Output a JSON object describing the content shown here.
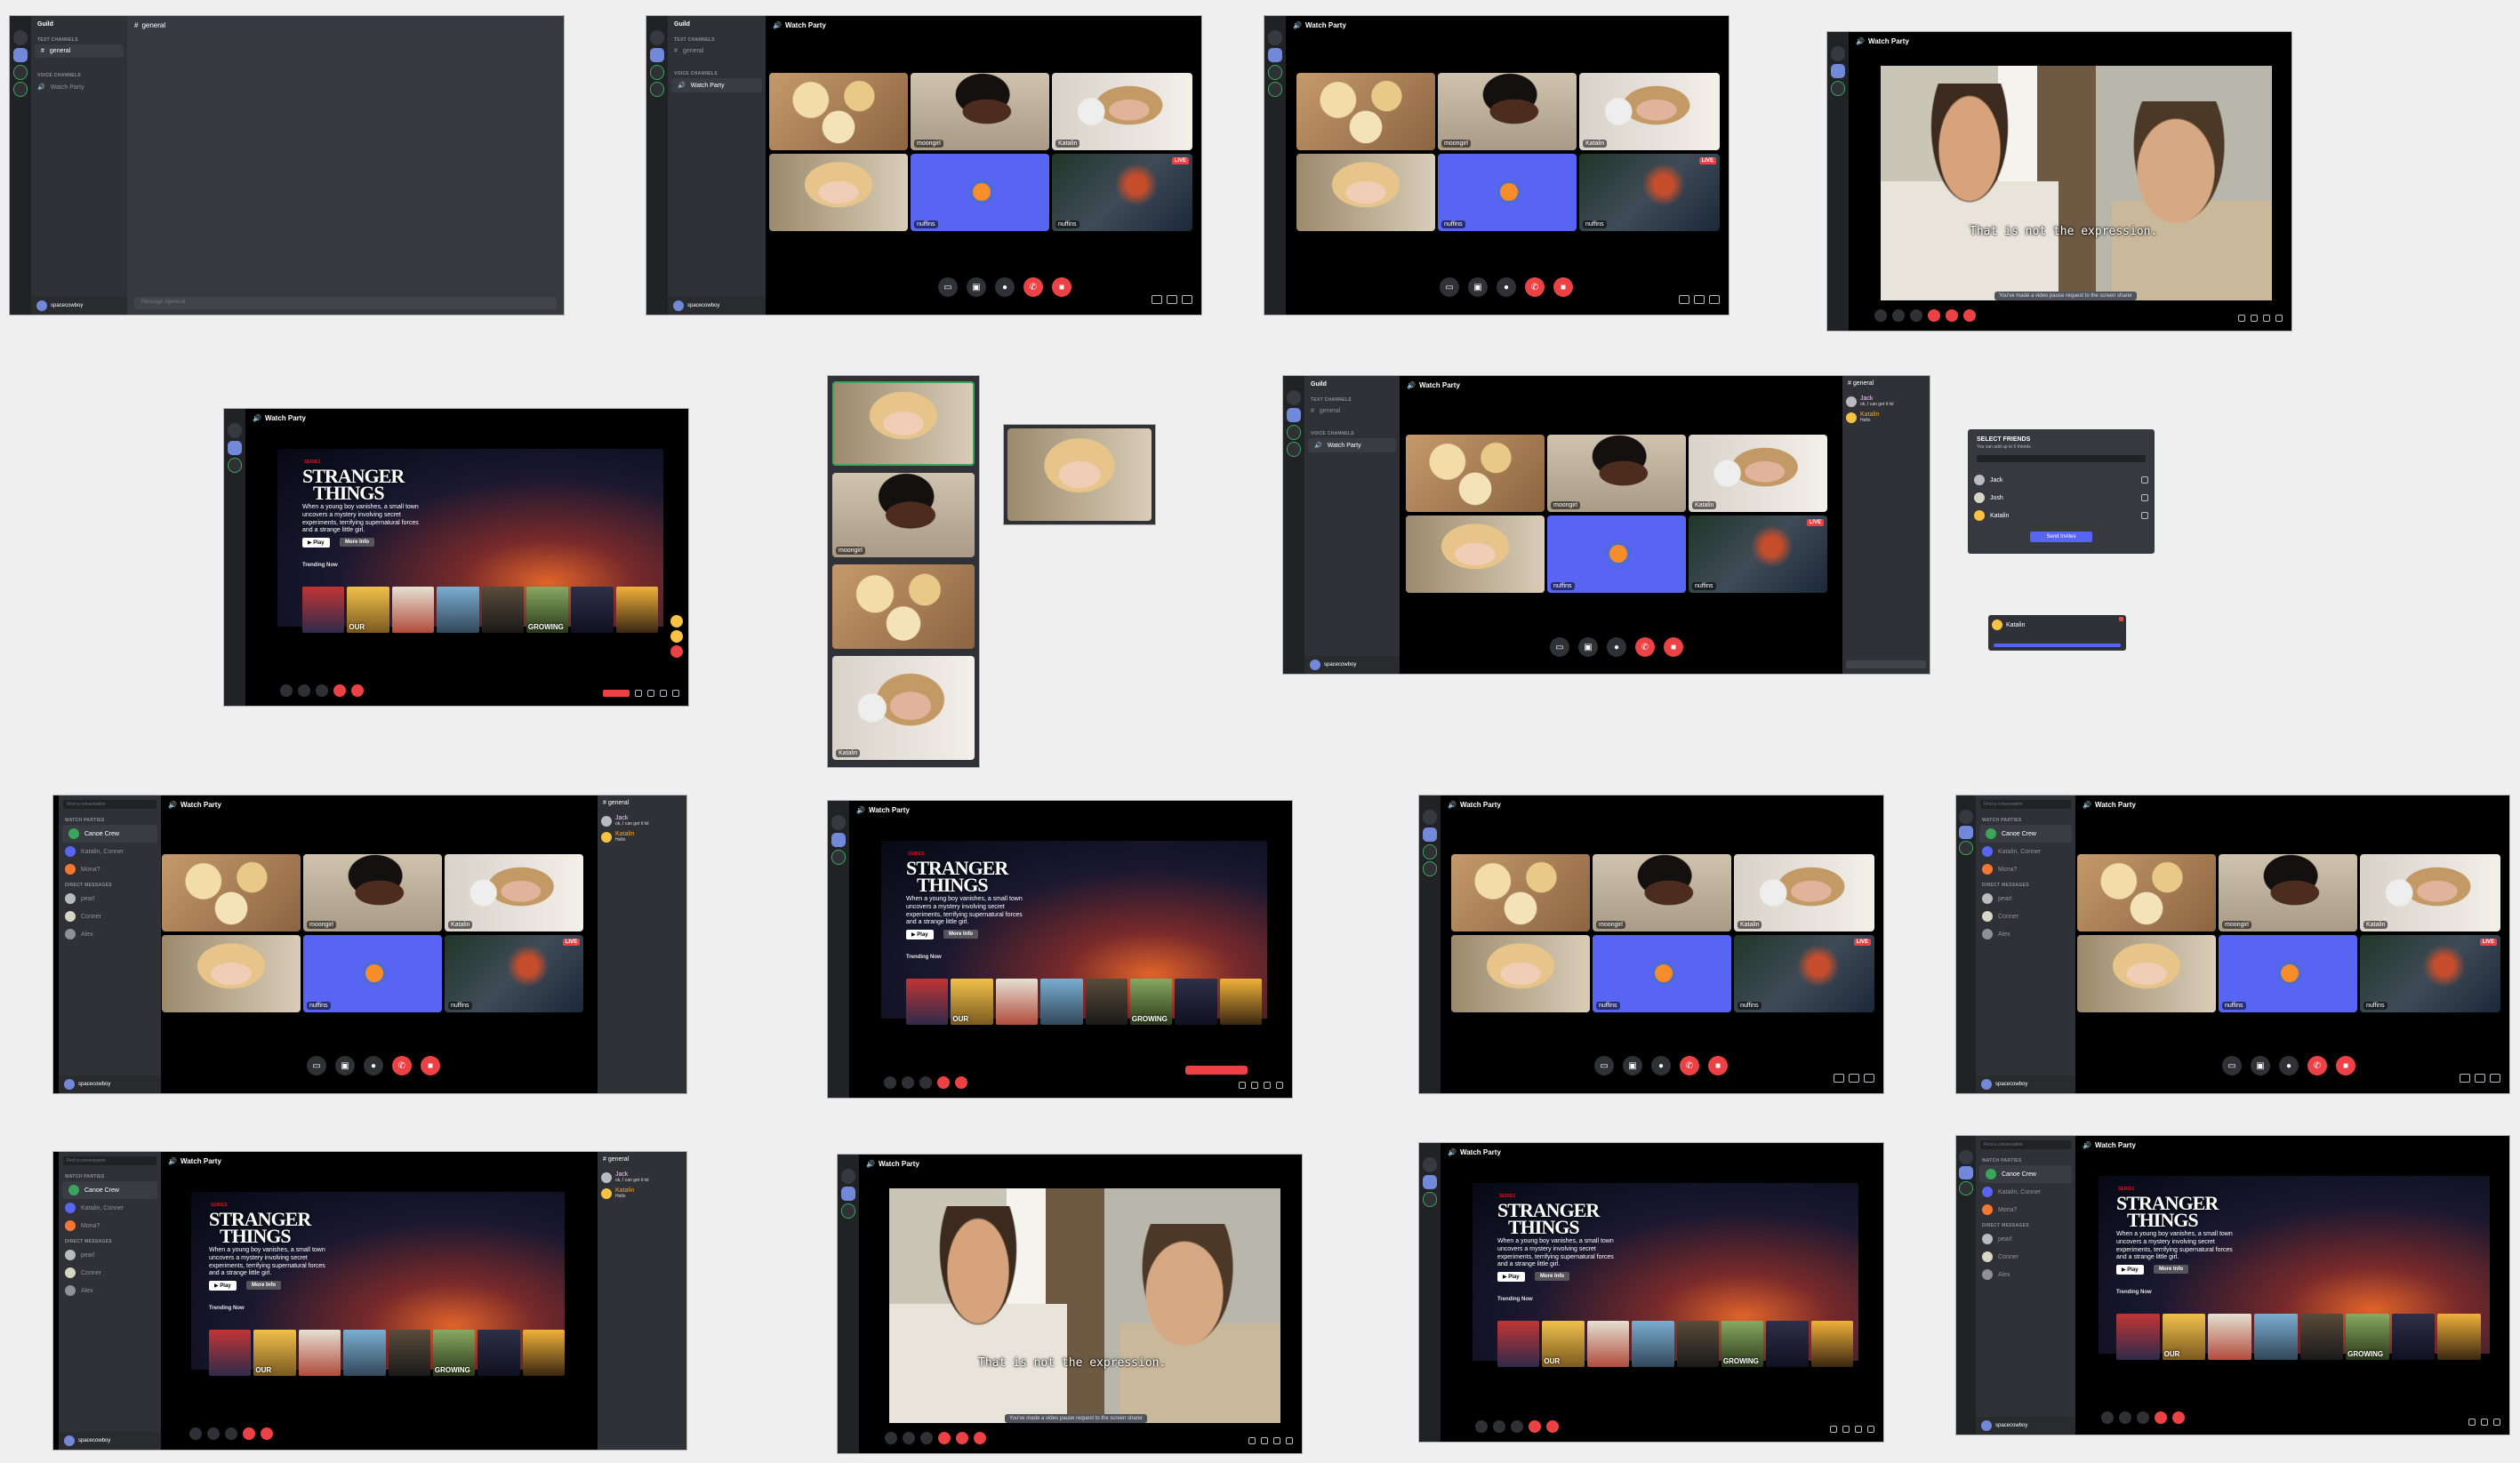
{
  "guild": {
    "name": "Guild",
    "text_channels": "TEXT CHANNELS",
    "voice_channels": "VOICE CHANNELS",
    "channel_general": "general",
    "channel_watch": "Watch Party"
  },
  "chat": {
    "title": "general",
    "placeholder": "Message #general"
  },
  "call": {
    "title": "Watch Party"
  },
  "participants": {
    "moongirl": "moongirl",
    "katalin": "Katalin",
    "nuffins": "nuffins",
    "live": "LIVE"
  },
  "user": {
    "name": "spacecowboy"
  },
  "netflix": {
    "series": "SERIES",
    "title_line1": "STRANGER",
    "title_line2": "THINGS",
    "description": "When a young boy vanishes, a small town uncovers a mystery involving secret experiments, terrifying supernatural forces and a strange little girl.",
    "play": "Play",
    "more_info": "More Info",
    "trending": "Trending Now",
    "poster_labels": [
      "",
      "OUR",
      "",
      "",
      "",
      "GROWING",
      "",
      ""
    ]
  },
  "office": {
    "subtitle": "That is not the expression.",
    "notice": "You've made a video pause request to the screen sharer"
  },
  "select_friends": {
    "title": "SELECT FRIENDS",
    "subtitle": "You can add up to 6 friends",
    "friends": [
      "Jack",
      "Josh",
      "Katalin"
    ],
    "button": "Send Invites"
  },
  "dm": {
    "search": "Find a conversation",
    "watch_parties": "WATCH PARTIES",
    "direct_messages": "DIRECT MESSAGES",
    "parties": [
      "Canoe Crew",
      "Katalin, Conner",
      "Mona?"
    ],
    "contacts": [
      "pearl",
      "Conner",
      "Alex"
    ]
  },
  "messages": [
    {
      "author": "Jack",
      "text": "ok, I can get it lol"
    },
    {
      "author": "Katalin",
      "text": "Hello"
    }
  ],
  "popup": {
    "author": "Katalin"
  },
  "colors": {
    "blurple": "#5865f2",
    "red": "#ed4245",
    "dark": "#36393f",
    "green": "#3ba55c"
  },
  "icons": [
    "speaker-icon",
    "expand-icon",
    "camera-icon",
    "screen-share-icon",
    "mic-icon",
    "hangup-icon",
    "chat-icon",
    "popout-icon",
    "fullscreen-icon",
    "add-user-icon"
  ]
}
